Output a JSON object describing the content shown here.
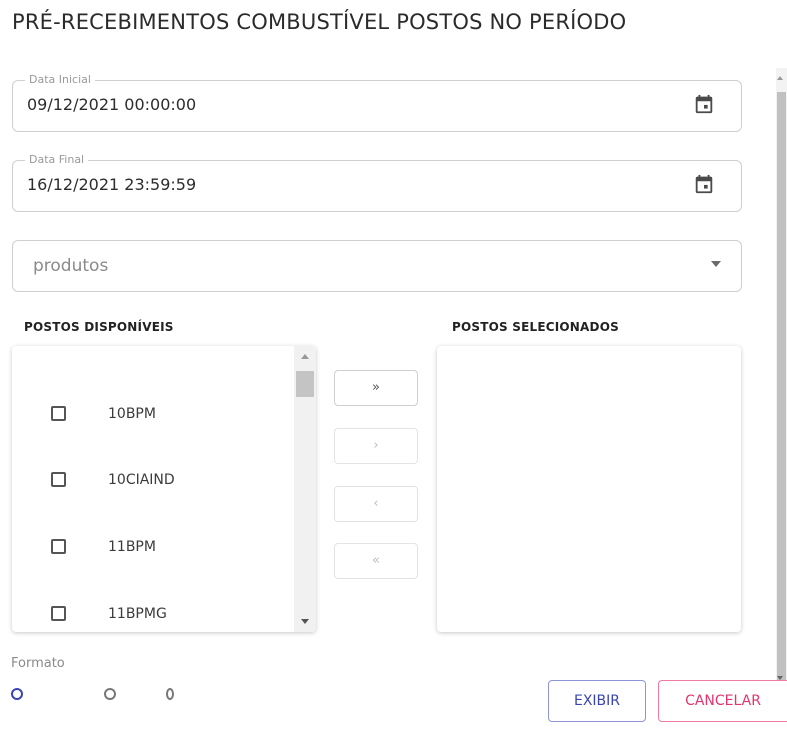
{
  "title": "PRÉ-RECEBIMENTOS COMBUSTÍVEL POSTOS NO PERÍODO",
  "data_inicial": {
    "label": "Data Inicial",
    "value": "09/12/2021 00:00:00"
  },
  "data_final": {
    "label": "Data Final",
    "value": "16/12/2021 23:59:59"
  },
  "produtos": {
    "placeholder": "produtos"
  },
  "postos_disponiveis": {
    "header": "POSTOS DISPONÍVEIS",
    "items": [
      {
        "label": "10BPM",
        "checked": false
      },
      {
        "label": "10CIAIND",
        "checked": false
      },
      {
        "label": "11BPM",
        "checked": false
      },
      {
        "label": "11BPMG",
        "checked": false
      }
    ]
  },
  "postos_selecionados": {
    "header": "POSTOS SELECIONADOS",
    "items": []
  },
  "transfer_buttons": {
    "add_all": "»",
    "add": "›",
    "remove": "‹",
    "remove_all": "«"
  },
  "formato": {
    "label": "Formato"
  },
  "buttons": {
    "exibir": "EXIBIR",
    "cancelar": "CANCELAR"
  },
  "colors": {
    "primary": "#3a45b5",
    "danger": "#e2356f"
  }
}
